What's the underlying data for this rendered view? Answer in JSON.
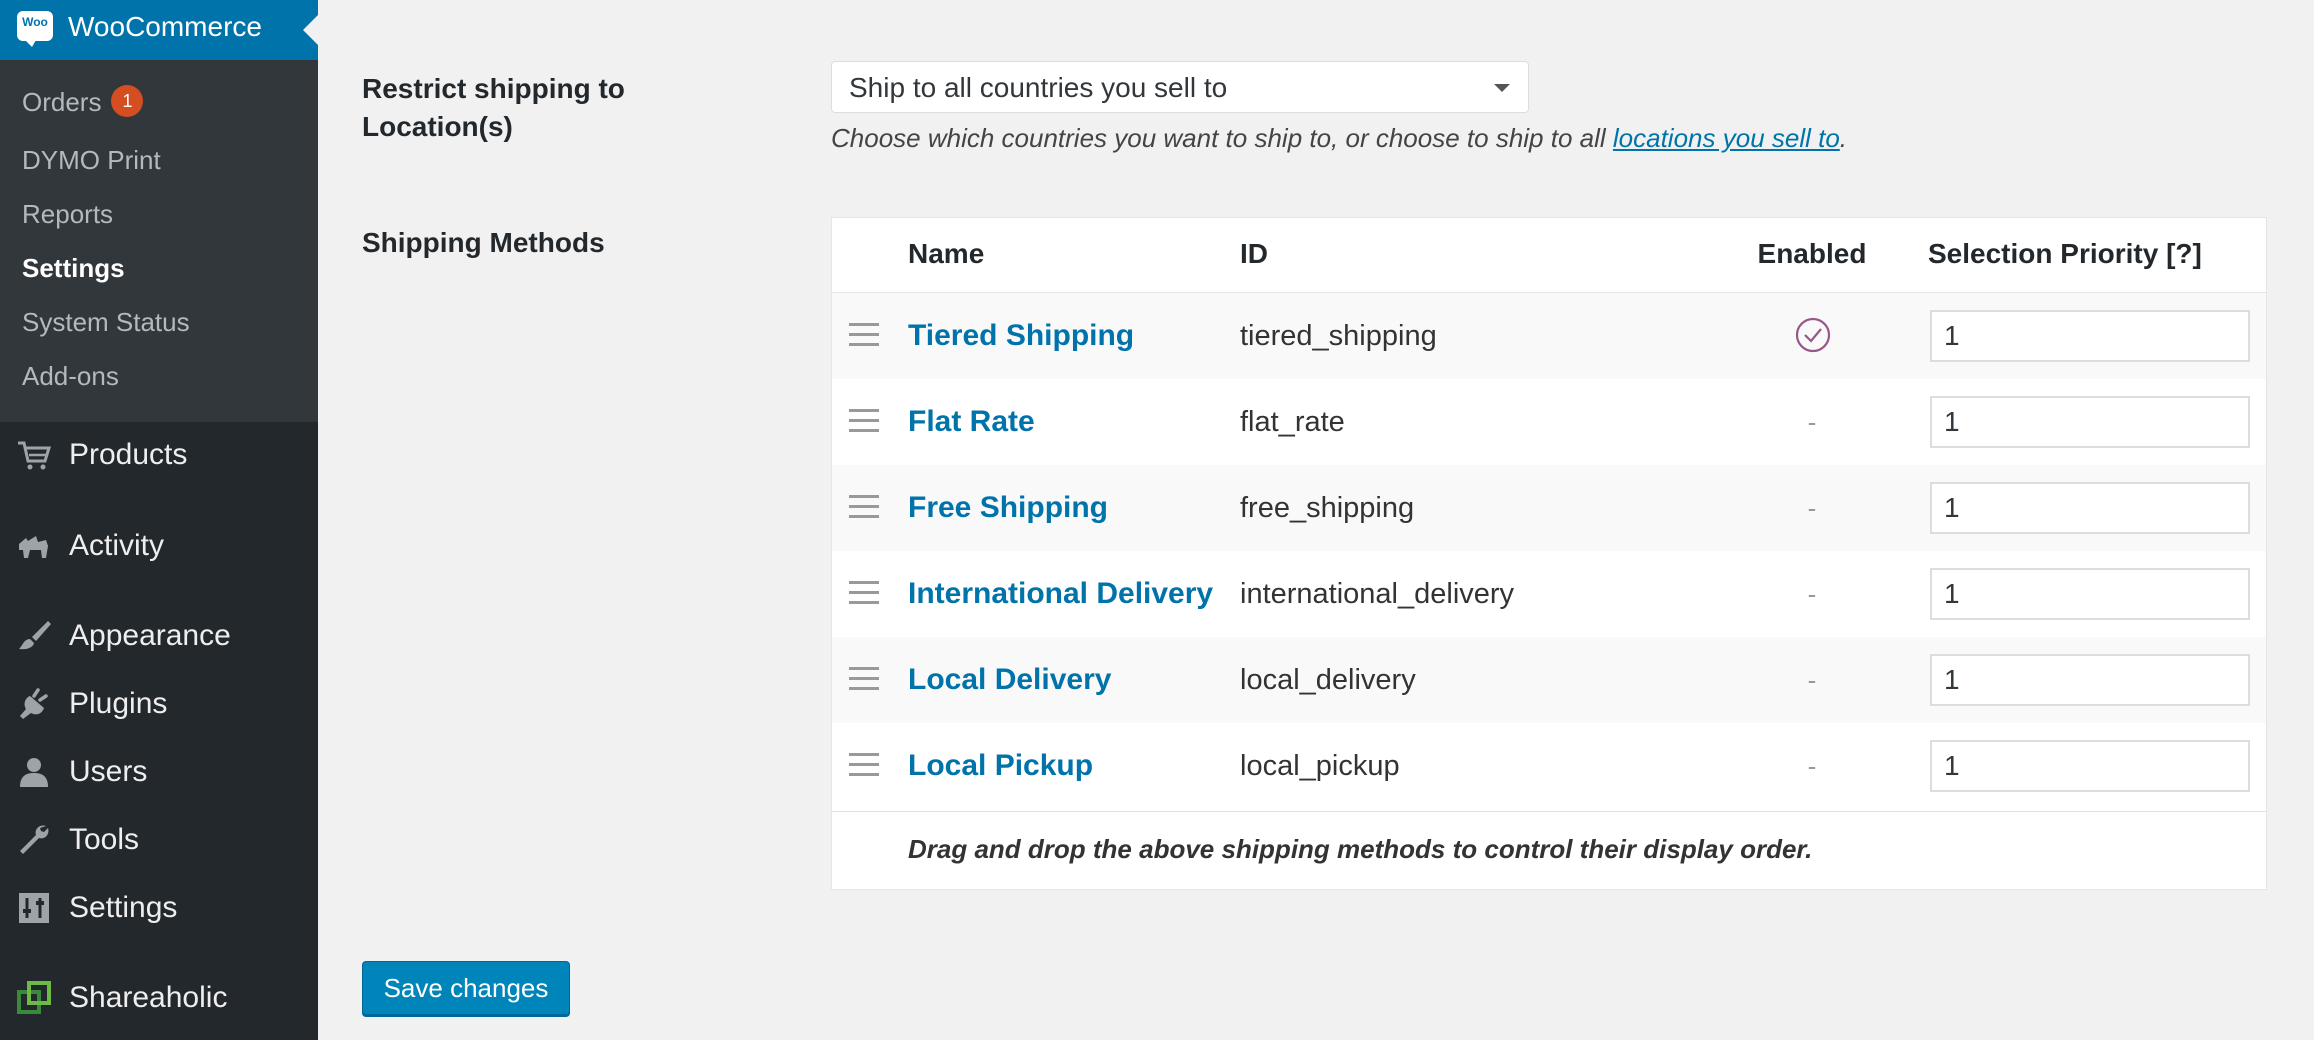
{
  "sidebar": {
    "header": {
      "logo_text": "Woo",
      "title": "WooCommerce"
    },
    "submenu": [
      {
        "label": "Orders",
        "badge": "1"
      },
      {
        "label": "DYMO Print"
      },
      {
        "label": "Reports"
      },
      {
        "label": "Settings",
        "current": true
      },
      {
        "label": "System Status"
      },
      {
        "label": "Add-ons"
      }
    ],
    "menu": [
      {
        "label": "Products",
        "icon": "cart-icon"
      },
      {
        "label": "Activity",
        "icon": "activity-icon"
      },
      {
        "label": "Appearance",
        "icon": "paintbrush-icon"
      },
      {
        "label": "Plugins",
        "icon": "plug-icon"
      },
      {
        "label": "Users",
        "icon": "user-icon"
      },
      {
        "label": "Tools",
        "icon": "wrench-icon"
      },
      {
        "label": "Settings",
        "icon": "settings-sliders-icon"
      },
      {
        "label": "Shareaholic",
        "icon": "shareaholic-icon"
      }
    ]
  },
  "restrict": {
    "label": "Restrict shipping to Location(s)",
    "selected": "Ship to all countries you sell to",
    "help_prefix": "Choose which countries you want to ship to, or choose to ship to all ",
    "help_link": "locations you sell to",
    "help_suffix": "."
  },
  "methods": {
    "label": "Shipping Methods",
    "columns": {
      "name": "Name",
      "id": "ID",
      "enabled": "Enabled",
      "priority": "Selection Priority [?]"
    },
    "rows": [
      {
        "name": "Tiered Shipping",
        "id": "tiered_shipping",
        "enabled": true,
        "enabled_text": "",
        "priority": "1"
      },
      {
        "name": "Flat Rate",
        "id": "flat_rate",
        "enabled": false,
        "enabled_text": "-",
        "priority": "1"
      },
      {
        "name": "Free Shipping",
        "id": "free_shipping",
        "enabled": false,
        "enabled_text": "-",
        "priority": "1"
      },
      {
        "name": "International Delivery",
        "id": "international_delivery",
        "enabled": false,
        "enabled_text": "-",
        "priority": "1"
      },
      {
        "name": "Local Delivery",
        "id": "local_delivery",
        "enabled": false,
        "enabled_text": "-",
        "priority": "1"
      },
      {
        "name": "Local Pickup",
        "id": "local_pickup",
        "enabled": false,
        "enabled_text": "-",
        "priority": "1"
      }
    ],
    "footer_note": "Drag and drop the above shipping methods to control their display order."
  },
  "save_label": "Save changes",
  "colors": {
    "accent": "#0073aa",
    "enabled_check": "#96588a",
    "badge": "#d54e21",
    "sidebar_bg": "#23282d",
    "submenu_bg": "#32373c"
  }
}
